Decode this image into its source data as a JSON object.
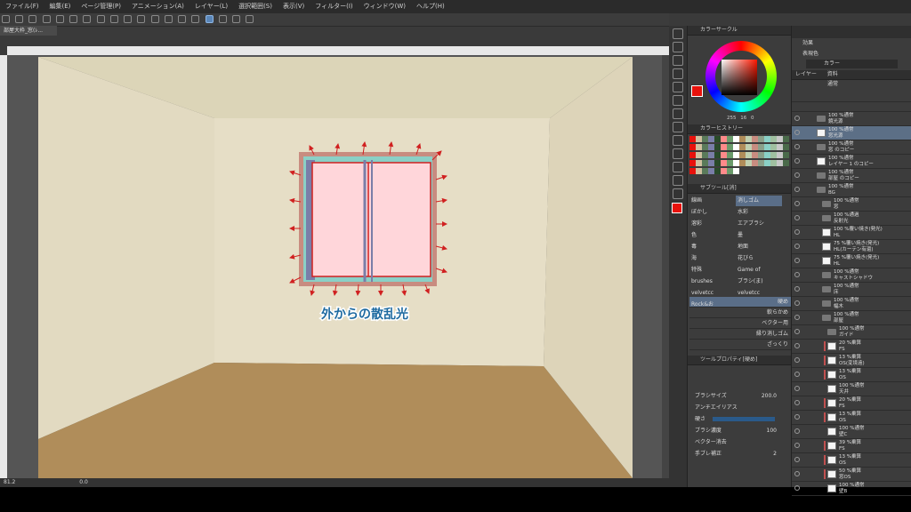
{
  "menu": [
    "ファイル(F)",
    "編集(E)",
    "ページ管理(P)",
    "アニメーション(A)",
    "レイヤー(L)",
    "選択範囲(S)",
    "表示(V)",
    "フィルター(I)",
    "ウィンドウ(W)",
    "ヘルプ(H)"
  ],
  "doc_tab": "部屋大枠_窓(ﾚ...",
  "canvas_caption": "外からの散乱光",
  "status": {
    "zoom": "81.2",
    "angle": "0.0"
  },
  "color_wheel": {
    "title": "カラーサークル",
    "values": [
      "255",
      "16",
      "0"
    ],
    "main_color": "#e8120c"
  },
  "color_history": {
    "title": "カラーヒストリー"
  },
  "subtool": {
    "title": "サブツール[消]",
    "items": [
      "線画",
      "消しゴム",
      "ぼかし",
      "水彩",
      "溶彩",
      "エアブラシ",
      "色",
      "墨",
      "毒",
      "地面",
      "海",
      "花びら",
      "特殊",
      "Game of",
      "brushes",
      "ブラシ(ま)",
      "velvetcc",
      "velvetcc",
      "Rock&お"
    ],
    "strokes": [
      "硬め",
      "軟らかめ",
      "ベクター用",
      "縁り消しゴム",
      "ざっくり"
    ]
  },
  "tool_property": {
    "title": "ツールプロパティ[硬め]",
    "brush_size_label": "ブラシサイズ",
    "brush_size": "200.0",
    "antialias_label": "アンチエイリアス",
    "hardness_label": "硬さ",
    "density_label": "ブラシ濃度",
    "density": "100",
    "vector_erase_label": "ベクター消去",
    "stabilization_label": "手ブレ補正",
    "stabilization": "2"
  },
  "effect_panel": {
    "title": "効果",
    "color_label": "表現色",
    "color_value": "カラー"
  },
  "layer_panel": {
    "tabs": [
      "レイヤー",
      "資料"
    ],
    "blend": "通常",
    "layers": [
      {
        "l1": "100 %通常",
        "l2": "鏡光源",
        "kind": "folder",
        "indent": 0,
        "bar": ""
      },
      {
        "l1": "100 %通常",
        "l2": "窓光源",
        "kind": "thumb",
        "indent": 0,
        "bar": "",
        "sel": true
      },
      {
        "l1": "100 %通常",
        "l2": "窓 のコピー",
        "kind": "folder",
        "indent": 0,
        "bar": ""
      },
      {
        "l1": "100 %通常",
        "l2": "レイヤー 1 のコピー",
        "kind": "thumb",
        "indent": 0,
        "bar": ""
      },
      {
        "l1": "100 %通常",
        "l2": "部屋 のコピー",
        "kind": "folder",
        "indent": 0,
        "bar": ""
      },
      {
        "l1": "100 %通常",
        "l2": "BG",
        "kind": "folder",
        "indent": 0,
        "bar": ""
      },
      {
        "l1": "100 %通常",
        "l2": "窓",
        "kind": "folder",
        "indent": 1,
        "bar": ""
      },
      {
        "l1": "100 %通過",
        "l2": "反射光",
        "kind": "folder",
        "indent": 1,
        "bar": ""
      },
      {
        "l1": "100 %覆い焼き(発光)",
        "l2": "HL",
        "kind": "thumb",
        "indent": 1,
        "bar": ""
      },
      {
        "l1": "75 %覆い焼き(発光)",
        "l2": "HL(カーテン有還)",
        "kind": "thumb",
        "indent": 1,
        "bar": ""
      },
      {
        "l1": "75 %覆い焼き(発光)",
        "l2": "HL",
        "kind": "thumb",
        "indent": 1,
        "bar": ""
      },
      {
        "l1": "100 %通常",
        "l2": "キャストシャドウ",
        "kind": "folder",
        "indent": 1,
        "bar": ""
      },
      {
        "l1": "100 %通常",
        "l2": "床",
        "kind": "folder",
        "indent": 1,
        "bar": ""
      },
      {
        "l1": "100 %通常",
        "l2": "幅木",
        "kind": "folder",
        "indent": 1,
        "bar": ""
      },
      {
        "l1": "100 %通常",
        "l2": "部屋",
        "kind": "folder",
        "indent": 1,
        "bar": ""
      },
      {
        "l1": "100 %通常",
        "l2": "ガイド",
        "kind": "folder",
        "indent": 2,
        "bar": ""
      },
      {
        "l1": "20 %乗算",
        "l2": "FS",
        "kind": "thumb",
        "indent": 2,
        "bar": "#c05050"
      },
      {
        "l1": "13 %乗算",
        "l2": "OS(変境遠)",
        "kind": "thumb",
        "indent": 2,
        "bar": "#c05050"
      },
      {
        "l1": "13 %乗算",
        "l2": "OS",
        "kind": "thumb",
        "indent": 2,
        "bar": "#c05050"
      },
      {
        "l1": "100 %通常",
        "l2": "天井",
        "kind": "thumb",
        "indent": 2,
        "bar": ""
      },
      {
        "l1": "20 %乗算",
        "l2": "FS",
        "kind": "thumb",
        "indent": 2,
        "bar": "#c05050"
      },
      {
        "l1": "13 %乗算",
        "l2": "OS",
        "kind": "thumb",
        "indent": 2,
        "bar": "#c05050"
      },
      {
        "l1": "100 %通常",
        "l2": "壁C",
        "kind": "thumb",
        "indent": 2,
        "bar": ""
      },
      {
        "l1": "39 %乗算",
        "l2": "FS",
        "kind": "thumb",
        "indent": 2,
        "bar": "#c05050"
      },
      {
        "l1": "13 %乗算",
        "l2": "OS",
        "kind": "thumb",
        "indent": 2,
        "bar": "#c05050"
      },
      {
        "l1": "50 %乗算",
        "l2": "窓OS",
        "kind": "thumb",
        "indent": 2,
        "bar": "#c05050"
      },
      {
        "l1": "100 %通常",
        "l2": "壁B",
        "kind": "thumb",
        "indent": 2,
        "bar": ""
      }
    ]
  }
}
